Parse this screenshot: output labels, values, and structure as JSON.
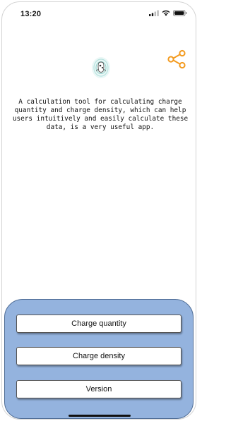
{
  "status_bar": {
    "time": "13:20",
    "icons": [
      "signal-icon",
      "wifi-icon",
      "battery-icon"
    ]
  },
  "header": {
    "share_icon": "share-icon",
    "accent_color": "#f39a1e"
  },
  "logo": {
    "icon": "app-logo-icon"
  },
  "description": {
    "text": "A calculation tool for calculating charge quantity and charge density, which can help users intuitively and easily calculate these data, is a very useful app."
  },
  "menu": {
    "panel_color": "#94b3de",
    "buttons": [
      {
        "label": "Charge quantity"
      },
      {
        "label": "Charge density"
      },
      {
        "label": "Version"
      }
    ]
  }
}
